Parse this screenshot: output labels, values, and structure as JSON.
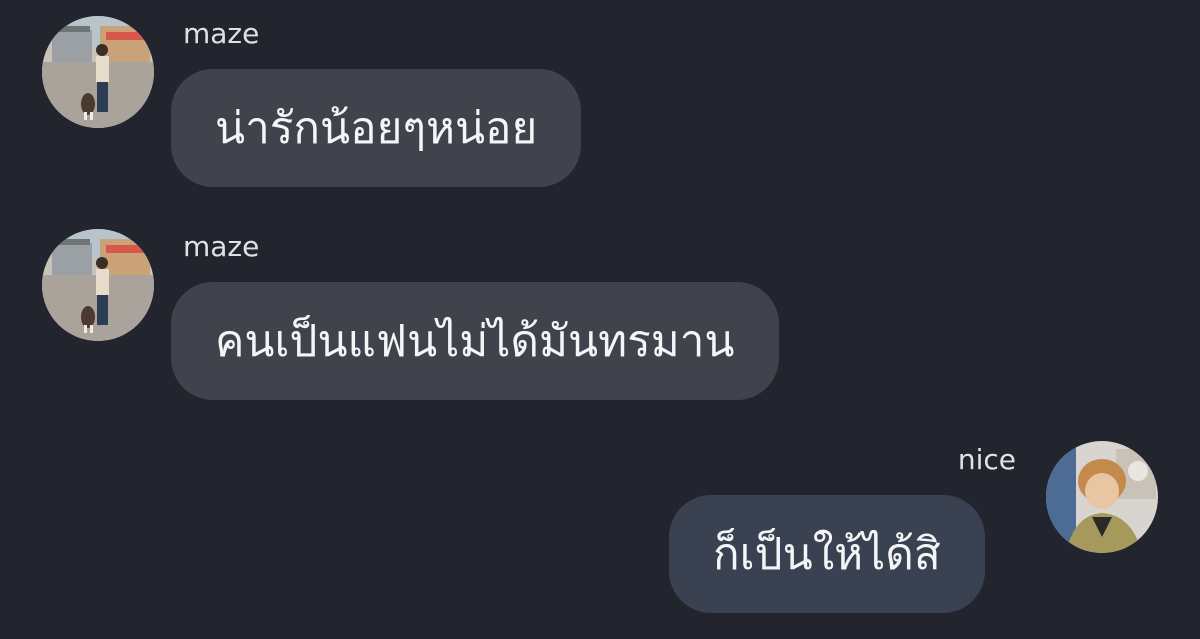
{
  "colors": {
    "background": "#22252d",
    "incoming_bubble": "#40434b",
    "outgoing_bubble": "#3a4150",
    "text": "#f4f5f7",
    "sender_text": "#dfe1e6"
  },
  "messages": [
    {
      "sender": "maze",
      "text": "น่ารักน้อยๆหน่อย",
      "direction": "incoming",
      "avatar_icon": "user-avatar-maze"
    },
    {
      "sender": "maze",
      "text": "คนเป็นแฟนไม่ได้มันทรมาน",
      "direction": "incoming",
      "avatar_icon": "user-avatar-maze"
    },
    {
      "sender": "nice",
      "text": "ก็เป็นให้ได้สิ",
      "direction": "outgoing",
      "avatar_icon": "user-avatar-nice"
    }
  ]
}
